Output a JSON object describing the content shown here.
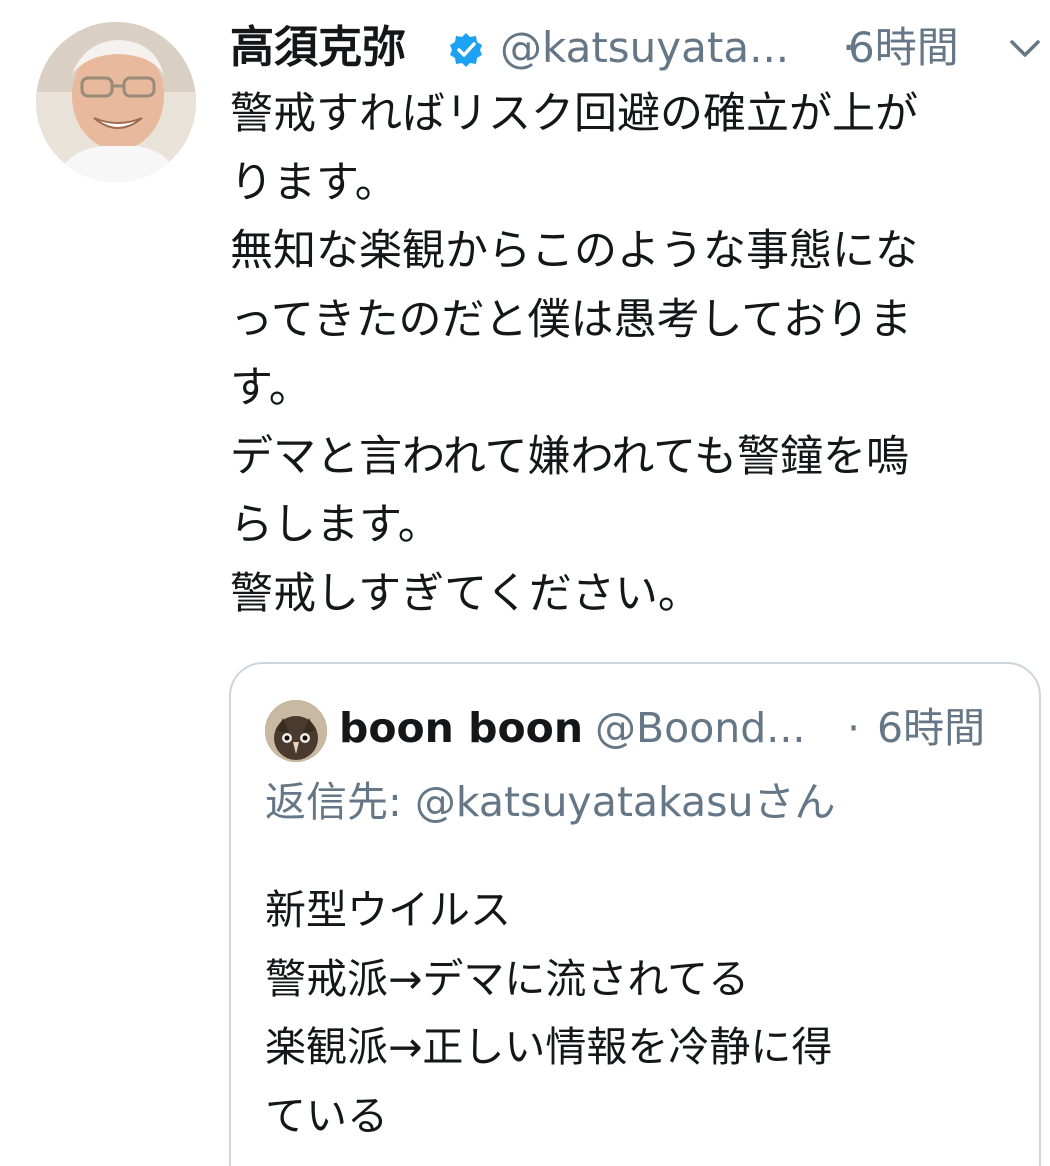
{
  "tweet": {
    "display_name": "高須克弥",
    "verified": true,
    "handle": "@katsuyata...",
    "separator": "·",
    "time": "6時間",
    "menu_icon": "chevron-down-icon",
    "text_lines": [
      "警戒すればリスク回避の確立が上が",
      "ります。",
      "無知な楽観からこのような事態にな",
      "ってきたのだと僕は愚考しておりま",
      "す。",
      "デマと言われて嫌われても警鐘を鳴",
      "らします。",
      "警戒しすぎてください。"
    ]
  },
  "quoted_tweet": {
    "display_name": "boon boon",
    "handle": "@Boond...",
    "separator": "·",
    "time": "6時間",
    "reply_prefix": "返信先: ",
    "reply_mention": "@katsuyatakasu",
    "reply_suffix": "さん",
    "text_lines": [
      "新型ウイルス",
      "警戒派→デマに流されてる",
      "楽観派→正しい情報を冷静に得",
      "ている"
    ]
  },
  "colors": {
    "text_primary": "#14171a",
    "text_secondary": "#657786",
    "verified_blue": "#1da1f2",
    "border": "#ccd6dd"
  }
}
